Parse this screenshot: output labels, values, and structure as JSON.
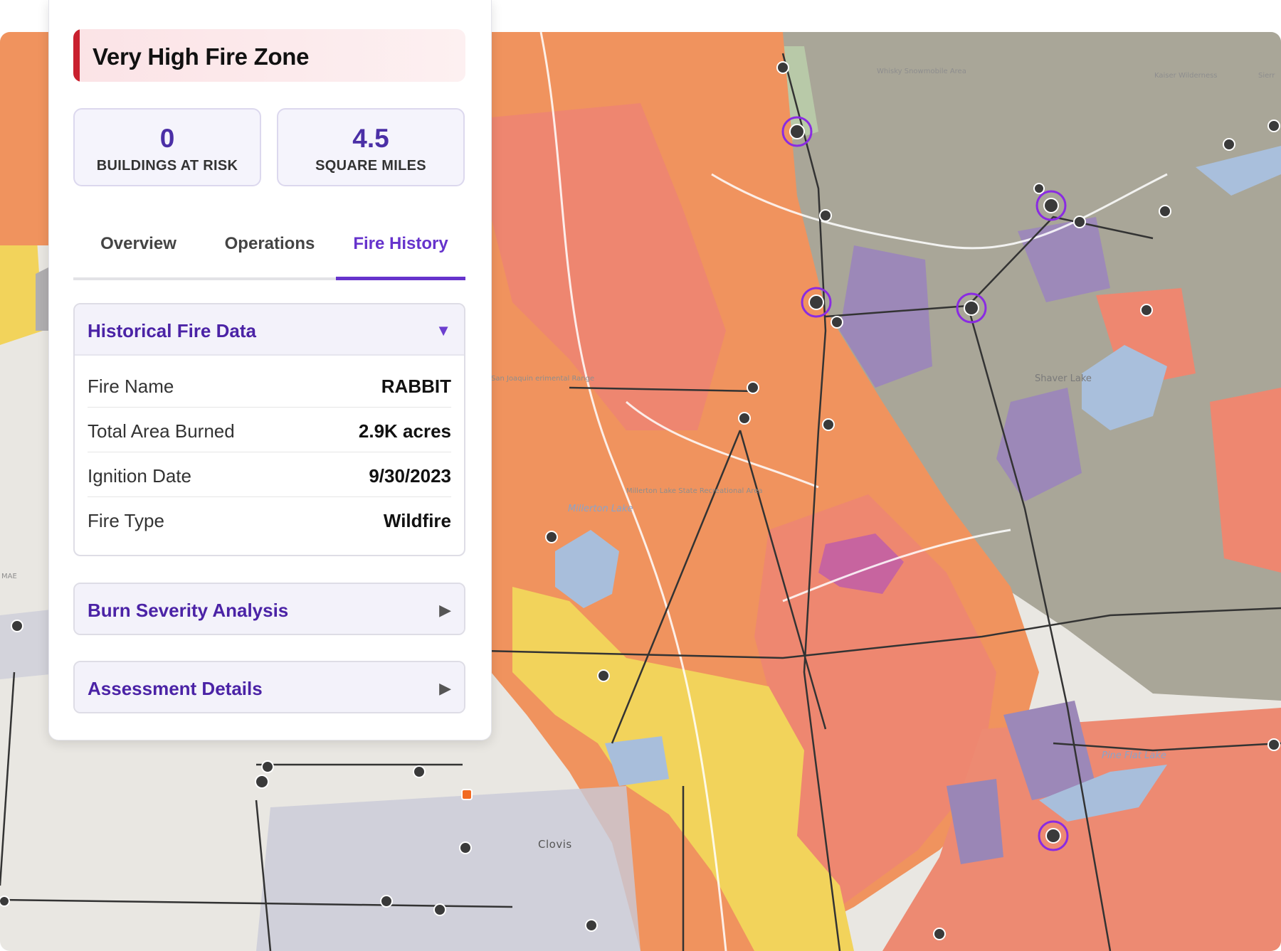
{
  "panel": {
    "zone_title": "Very High Fire Zone",
    "stats": [
      {
        "value": "0",
        "label": "BUILDINGS AT RISK"
      },
      {
        "value": "4.5",
        "label": "SQUARE MILES"
      }
    ],
    "tabs": [
      {
        "label": "Overview",
        "active": false
      },
      {
        "label": "Operations",
        "active": false
      },
      {
        "label": "Fire History",
        "active": true
      }
    ],
    "sections": [
      {
        "title": "Historical Fire Data",
        "expanded": true,
        "rows": [
          {
            "key": "Fire Name",
            "value": "RABBIT"
          },
          {
            "key": "Total Area Burned",
            "value": "2.9K acres"
          },
          {
            "key": "Ignition Date",
            "value": "9/30/2023"
          },
          {
            "key": "Fire Type",
            "value": "Wildfire"
          }
        ]
      },
      {
        "title": "Burn Severity Analysis",
        "expanded": false
      },
      {
        "title": "Assessment Details",
        "expanded": false
      }
    ]
  },
  "map": {
    "labels": {
      "whisky": "Whisky Snowmobile Area",
      "kaiser": "Kaiser Wilderness",
      "sierra": "Sierr",
      "san_joaquin": "San Joaquin erimental Range",
      "shaver": "Shaver Lake",
      "millerton_lake": "Millerton Lake",
      "millerton_sra": "Millerton Lake State Recreational Area",
      "pine_flat": "Pine Flat Lake",
      "clovis": "Clovis",
      "mae": "MAE"
    },
    "colors": {
      "base": "#e8e6e0",
      "terrain": "#a8a597",
      "green": "#b9ccac",
      "orange": "#f0935e",
      "salmon": "#ee8770",
      "yellow": "#f2d35b",
      "purple": "#9c88b8",
      "water": "#a9bfdc",
      "accent_purple": "#8a2be2",
      "panel_accent": "#6633cc",
      "zone_red": "#c9202e"
    },
    "icons": "transmission-tower-icon, fire-station-icon"
  }
}
